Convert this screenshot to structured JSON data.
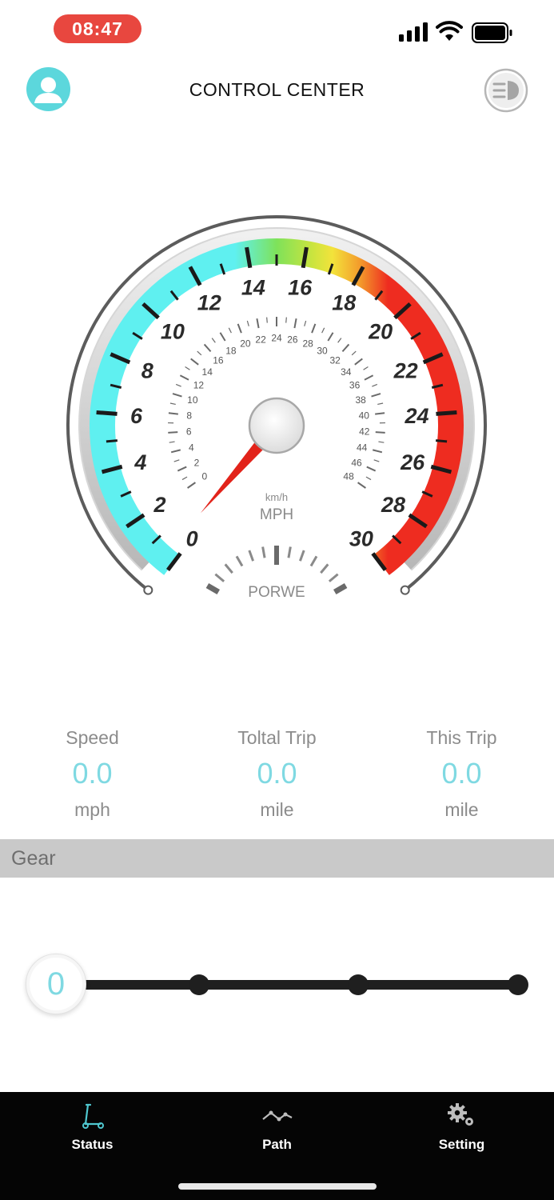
{
  "status_bar": {
    "time": "08:47",
    "time_pill_color": "#e8473f",
    "icons": [
      "signal-icon",
      "wifi-icon",
      "battery-icon"
    ]
  },
  "header": {
    "title": "CONTROL CENTER",
    "left_icon": "user-avatar-icon",
    "right_icon": "headlight-icon"
  },
  "gauge": {
    "unit_small": "km/h",
    "unit_large": "MPH",
    "power_label": "PORWE",
    "needle_value_mph": 0,
    "mph_ticks": [
      "0",
      "2",
      "4",
      "6",
      "8",
      "10",
      "12",
      "14",
      "16",
      "18",
      "20",
      "22",
      "24",
      "26",
      "28",
      "30"
    ],
    "kmh_ticks": [
      "0",
      "2",
      "4",
      "6",
      "8",
      "10",
      "12",
      "14",
      "16",
      "18",
      "20",
      "22",
      "24",
      "26",
      "28",
      "30",
      "32",
      "34",
      "36",
      "38",
      "40",
      "42",
      "44",
      "46",
      "48"
    ],
    "colors": {
      "cyan": "#5ff0f0",
      "green": "#7ee25a",
      "yellow": "#f3e33b",
      "red": "#ee2c20",
      "needle": "#e2231a"
    }
  },
  "stats": {
    "speed": {
      "label": "Speed",
      "value": "0.0",
      "unit": "mph"
    },
    "total_trip": {
      "label": "Toltal Trip",
      "value": "0.0",
      "unit": "mile"
    },
    "this_trip": {
      "label": "This Trip",
      "value": "0.0",
      "unit": "mile"
    }
  },
  "gear": {
    "section_label": "Gear",
    "current": "0",
    "levels": 4
  },
  "tabs": [
    {
      "label": "Status",
      "icon": "scooter-icon",
      "active": true
    },
    {
      "label": "Path",
      "icon": "path-icon",
      "active": false
    },
    {
      "label": "Setting",
      "icon": "gears-icon",
      "active": false
    }
  ],
  "accent_color": "#7fd9e2"
}
